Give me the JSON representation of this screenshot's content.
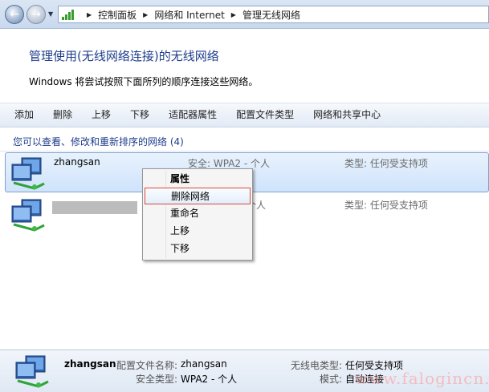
{
  "address": {
    "segments": [
      "控制面板",
      "网络和 Internet",
      "管理无线网络"
    ]
  },
  "header": {
    "title": "管理使用(无线网络连接)的无线网络",
    "subtitle": "Windows 将尝试按照下面所列的顺序连接这些网络。"
  },
  "toolbar": {
    "add": "添加",
    "delete": "删除",
    "move_up": "上移",
    "move_down": "下移",
    "adapter_properties": "适配器属性",
    "profile_types": "配置文件类型",
    "sharing_center": "网络和共享中心"
  },
  "list": {
    "section_title": "您可以查看、修改和重新排序的网络 (4)",
    "rows": [
      {
        "name": "zhangsan",
        "security": "安全: WPA2 - 个人",
        "type": "类型: 任何受支持项"
      },
      {
        "name": "",
        "security": "个人",
        "type": "类型: 任何受支持项"
      }
    ]
  },
  "context_menu": {
    "items": [
      "属性",
      "删除网络",
      "重命名",
      "上移",
      "下移"
    ]
  },
  "details": {
    "name": "zhangsan",
    "profile_label": "配置文件名称:",
    "profile_value": "zhangsan",
    "security_label": "安全类型:",
    "security_value": "WPA2 - 个人",
    "radio_label": "无线电类型:",
    "radio_value": "任何受支持项",
    "mode_label": "模式:",
    "mode_value": "自动连接"
  },
  "watermark": "www.falogincn.cn",
  "colors": {
    "heading": "#1e3d8c",
    "selected_row": "#cfe3fb",
    "menu_highlight_border": "#d94a3a"
  },
  "icons": [
    "back-arrow-icon",
    "forward-arrow-icon",
    "signal-bars-icon",
    "network-computers-icon"
  ]
}
